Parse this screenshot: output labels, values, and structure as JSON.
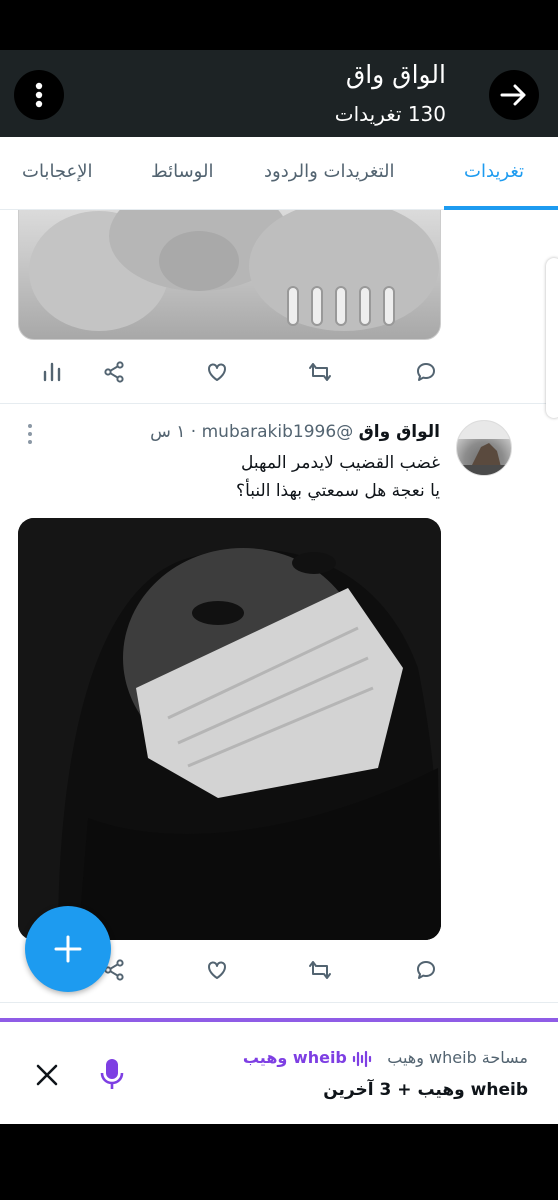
{
  "header": {
    "title": "الواق واق",
    "tweet_count": "130 تغريدات",
    "back_icon": "arrow-right-icon",
    "more_icon": "more-vertical-icon"
  },
  "tabs": [
    {
      "label": "تغريدات",
      "active": true
    },
    {
      "label": "التغريدات والردود",
      "active": false
    },
    {
      "label": "الوسائط",
      "active": false
    },
    {
      "label": "الإعجابات",
      "active": false
    }
  ],
  "tweet": {
    "name": "الواق واق",
    "handle": "@mubarakib1996",
    "time": "· ١ س",
    "lines": [
      "غضب القضيب لايدمر المهبل",
      "يا نعجة هل سمعتي بهذا النبأ؟"
    ]
  },
  "actions": [
    "reply-icon",
    "retweet-icon",
    "like-icon",
    "share-icon",
    "analytics-icon"
  ],
  "space_bar": {
    "label": "مساحة wheib وهيب",
    "host": "wheib وهيب",
    "participants": "wheib وهيب + 3 آخرين"
  },
  "colors": {
    "accent": "#1d9bf0",
    "space_purple": "#8f5ce6",
    "header_bg": "#1d2325"
  }
}
